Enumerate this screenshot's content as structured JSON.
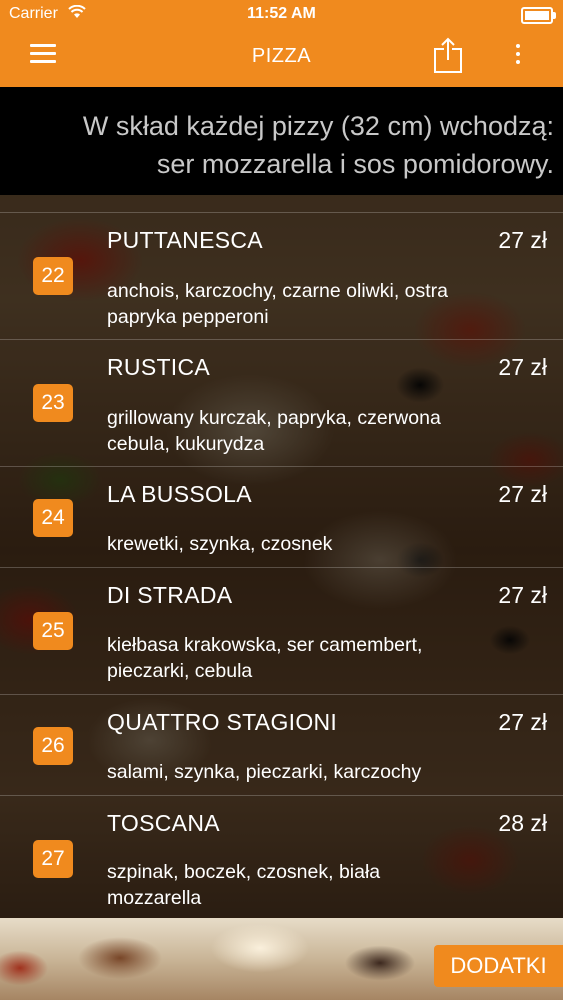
{
  "status_bar": {
    "carrier": "Carrier",
    "time": "11:52 AM"
  },
  "nav": {
    "title": "PIZZA",
    "menu_icon": "hamburger-menu-icon",
    "share_icon": "share-icon",
    "more_icon": "more-vertical-icon"
  },
  "banner": {
    "line1": "W skład każdej pizzy (32 cm) wchodzą:",
    "line2": "ser mozzarella i sos pomidorowy."
  },
  "items": [
    {
      "number": "22",
      "name": "PUTTANESCA",
      "price": "27 zł",
      "desc1": "anchois, karczochy, czarne oliwki, ostra",
      "desc2": "papryka pepperoni"
    },
    {
      "number": "23",
      "name": "RUSTICA",
      "price": "27 zł",
      "desc1": "grillowany kurczak, papryka, czerwona",
      "desc2": "cebula, kukurydza"
    },
    {
      "number": "24",
      "name": "LA BUSSOLA",
      "price": "27 zł",
      "desc1": "krewetki, szynka, czosnek",
      "desc2": ""
    },
    {
      "number": "25",
      "name": "DI STRADA",
      "price": "27 zł",
      "desc1": "kiełbasa krakowska, ser camembert,",
      "desc2": "pieczarki, cebula"
    },
    {
      "number": "26",
      "name": "QUATTRO STAGIONI",
      "price": "27 zł",
      "desc1": "salami, szynka, pieczarki, karczochy",
      "desc2": ""
    },
    {
      "number": "27",
      "name": "TOSCANA",
      "price": "28 zł",
      "desc1": "szpinak, boczek, czosnek, biała",
      "desc2": "mozzarella"
    }
  ],
  "footer": {
    "dodatki_label": "DODATKI"
  },
  "colors": {
    "accent": "#f08a1e",
    "banner_bg": "#000000",
    "banner_text": "#c8c8c8"
  }
}
